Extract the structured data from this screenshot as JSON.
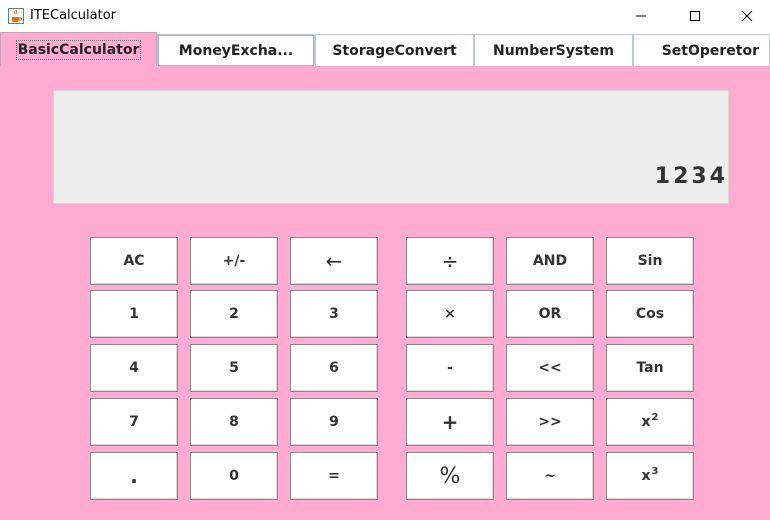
{
  "window": {
    "title": "ITECalculator",
    "icon": "java-cup-icon",
    "controls": [
      "minimize",
      "maximize",
      "close"
    ]
  },
  "tabs": [
    {
      "label": "BasicCalculator",
      "selected": true
    },
    {
      "label": "MoneyExcha...",
      "selected": false
    },
    {
      "label": "StorageConvert",
      "selected": false
    },
    {
      "label": "NumberSystem",
      "selected": false
    },
    {
      "label": "SetOperetor",
      "selected": false
    }
  ],
  "display": {
    "value": "1234"
  },
  "colors": {
    "panel": "#ffabd2",
    "display": "#eeeeee",
    "key": "#ffffff"
  },
  "keys": {
    "ac": "AC",
    "plus_minus": "+/-",
    "backspace": "←",
    "divide": "÷",
    "and": "AND",
    "sin": "Sin",
    "d1": "1",
    "d2": "2",
    "d3": "3",
    "multiply": "×",
    "or": "OR",
    "cos": "Cos",
    "d4": "4",
    "d5": "5",
    "d6": "6",
    "minus": "-",
    "shl": "<<",
    "tan": "Tan",
    "d7": "7",
    "d8": "8",
    "d9": "9",
    "plus": "+",
    "shr": ">>",
    "x": "x",
    "sq_exp": "2",
    "dot": ".",
    "d0": "0",
    "equals": "=",
    "percent": "%",
    "not": "~",
    "x3": "x",
    "cube_exp": "3"
  }
}
